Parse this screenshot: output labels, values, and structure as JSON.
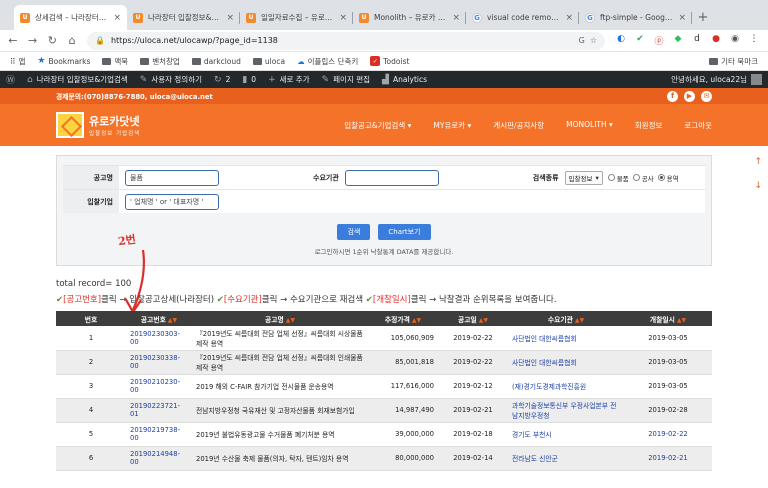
{
  "browser": {
    "tabs": [
      {
        "title": "상세검색 – 나라장터 입찰정보",
        "fav": "orange",
        "active": true
      },
      {
        "title": "나라장터 입찰정보&기업검색",
        "fav": "orange"
      },
      {
        "title": "일일자료수집 – 유로카 uloca",
        "fav": "orange"
      },
      {
        "title": "Monolith – 유로카 uloca",
        "fav": "orange"
      },
      {
        "title": "visual code remote ftp",
        "fav": "g"
      },
      {
        "title": "ftp-simple - Google 검색",
        "fav": "g"
      }
    ],
    "url": "https://uloca.net/ulocawp/?page_id=1138",
    "bookmarks": [
      "앱",
      "Bookmarks",
      "맥북",
      "벤처창업",
      "darkcloud",
      "uloca",
      "이플립스 단축키",
      "Todoist"
    ],
    "bookmarks_right": "기타 북마크"
  },
  "wp_admin": {
    "items": [
      "나라장터 입찰정보&기업검색",
      "사용자 정의하기",
      "2",
      "0",
      "새로 추가",
      "페이지 편집",
      "Analytics"
    ],
    "greeting": "안녕하세요, uloca22님"
  },
  "site": {
    "contact": "경제문의:(070)8876-7880, uloca@uloca.net",
    "logo_main": "유로카닷넷",
    "logo_sub": "입찰정보 기업검색",
    "menu": [
      "입찰공고&기업검색 ▾",
      "MY유로카 ▾",
      "게시판/공지사항",
      "MONOLITH ▾",
      "회원정보",
      "로그아웃"
    ]
  },
  "search": {
    "label_notice": "공고명",
    "notice_value": "물품",
    "label_demand": "수요기관",
    "demand_value": "",
    "label_type": "검색종류",
    "type_select": "입찰정보",
    "radios": [
      "물품",
      "공사",
      "용역"
    ],
    "label_company": "입찰기업",
    "company_placeholder": "' 업체명 ' or ' 대표자명 '",
    "btn_search": "검색",
    "btn_chart": "Chart보기",
    "note": "로그인하시면 1순위 낙찰통계 DATA를 제공합니다."
  },
  "results": {
    "total": "total record= 100",
    "help": [
      {
        "t": "✔",
        "c": "check"
      },
      {
        "t": "[공고번호]",
        "c": "hl"
      },
      {
        "t": "클릭 → 입찰공고상세(나라장터) ",
        "c": ""
      },
      {
        "t": "✔",
        "c": "check"
      },
      {
        "t": "[수요기관]",
        "c": "hl"
      },
      {
        "t": "클릭 → 수요기관으로 재검색 ",
        "c": ""
      },
      {
        "t": "✔",
        "c": "check"
      },
      {
        "t": "[개찰일시]",
        "c": "hl"
      },
      {
        "t": "클릭 → 낙찰결과 순위목록을 보여줍니다.",
        "c": ""
      }
    ],
    "columns": [
      "번호",
      "공고번호",
      "공고명",
      "추정가격",
      "공고일",
      "수요기관",
      "개찰일시"
    ],
    "rows": [
      {
        "no": "1",
        "id": "20190230303-00",
        "name": "『2019년도 씨름대회 전담 업체 선정』씨름대회 시상물품 제작 용역",
        "price": "105,060,909",
        "date": "2019-02-22",
        "org": "사단법인 대한씨름협회",
        "open": "2019-03-05",
        "open_link": false
      },
      {
        "no": "2",
        "id": "20190230338-00",
        "name": "『2019년도 씨름대회 전담 업체 선정』씨름대회 인쇄물품 제작 용역",
        "price": "85,001,818",
        "date": "2019-02-22",
        "org": "사단법인 대한씨름협회",
        "open": "2019-03-05",
        "open_link": false
      },
      {
        "no": "3",
        "id": "20190210230-00",
        "name": "2019 해외 C-FAIR 참가기업 전시물품 운송용역",
        "price": "117,616,000",
        "date": "2019-02-12",
        "org": "(재)경기도경제과학진흥원",
        "open": "2019-03-05",
        "open_link": false
      },
      {
        "no": "4",
        "id": "20190223721-01",
        "name": "전남지방우정청 국유재산 및 고정자산물품 회재보험가입",
        "price": "14,987,490",
        "date": "2019-02-21",
        "org": "과학기술정보통신부 우정사업본부 전남지방우정청",
        "open": "2019-02-28",
        "open_link": false
      },
      {
        "no": "5",
        "id": "20190219738-00",
        "name": "2019년 불법유동광고물 수거물품 폐기처분 용역",
        "price": "39,000,000",
        "date": "2019-02-18",
        "org": "경기도 부천시",
        "open": "2019-02-22",
        "open_link": true
      },
      {
        "no": "6",
        "id": "20190214948-00",
        "name": "2019년 수산물 축제 물품(의자, 탁자, 텐트)임차 용역",
        "price": "80,000,000",
        "date": "2019-02-14",
        "org": "전라남도 신안군",
        "open": "2019-02-21",
        "open_link": true
      }
    ]
  },
  "annotation": "2번"
}
